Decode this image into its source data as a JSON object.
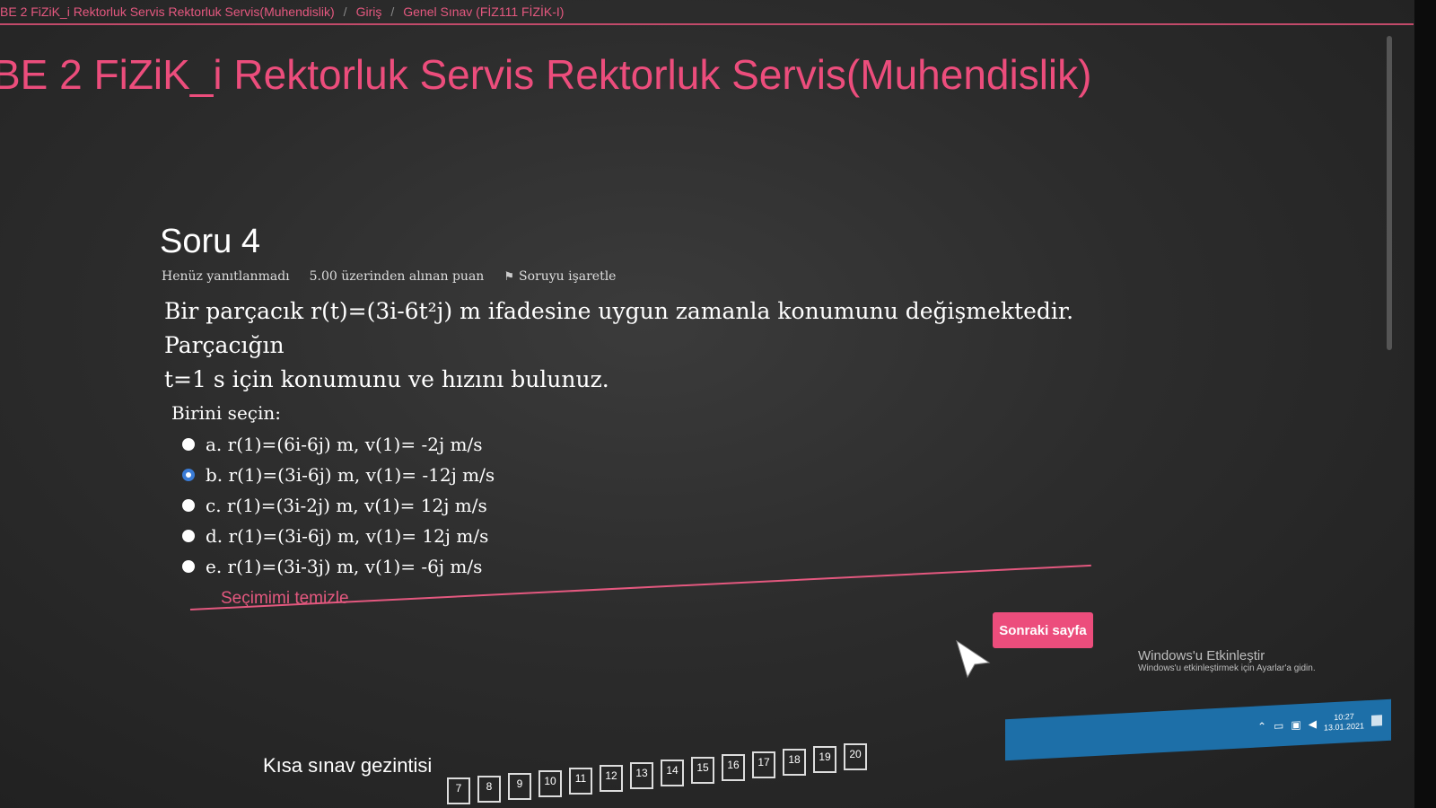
{
  "breadcrumb": {
    "course": "BE 2 FiZiK_i Rektorluk Servis Rektorluk Servis(Muhendislik)",
    "section": "Giriş",
    "quiz": "Genel Sınav (FİZ111 FİZİK-I)"
  },
  "course_title": "BE 2 FiZiK_i Rektorluk Servis Rektorluk Servis(Muhendislik)",
  "question": {
    "title": "Soru 4",
    "status": "Henüz yanıtlanmadı",
    "marks": "5.00 üzerinden alınan puan",
    "flag_label": "Soruyu işaretle",
    "text_line1": "Bir parçacık r(t)=(3i-6t²j) m ifadesine uygun zamanla konumunu değişmektedir. Parçacığın",
    "text_line2": "t=1 s için konumunu ve hızını bulunuz.",
    "prompt": "Birini seçin:",
    "options": [
      {
        "label": "a. r(1)=(6i-6j) m, v(1)= -2j m/s",
        "selected": false
      },
      {
        "label": "b. r(1)=(3i-6j) m, v(1)= -12j m/s",
        "selected": true
      },
      {
        "label": "c. r(1)=(3i-2j) m, v(1)= 12j m/s",
        "selected": false
      },
      {
        "label": "d. r(1)=(3i-6j) m, v(1)= 12j m/s",
        "selected": false
      },
      {
        "label": "e. r(1)=(3i-3j) m, v(1)= -6j m/s",
        "selected": false
      }
    ],
    "clear_label": "Seçimimi temizle"
  },
  "next_button": "Sonraki sayfa",
  "watermark": {
    "title": "Windows'u Etkinleştir",
    "subtitle": "Windows'u etkinleştirmek için Ayarlar'a gidin."
  },
  "quiz_nav": {
    "title": "Kısa sınav gezintisi",
    "buttons": [
      "7",
      "8",
      "9",
      "10",
      "11",
      "12",
      "13",
      "14",
      "15",
      "16",
      "17",
      "18",
      "19",
      "20"
    ]
  },
  "taskbar": {
    "time": "10:27",
    "date": "13.01.2021"
  },
  "colors": {
    "accent": "#ec4d7c",
    "selected_radio": "#3a7bd5",
    "taskbar": "#1d6fa8"
  }
}
